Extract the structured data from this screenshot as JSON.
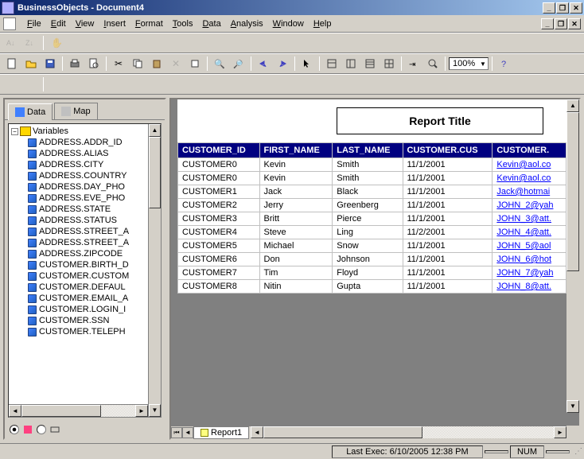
{
  "window": {
    "title": "BusinessObjects - Document4"
  },
  "menus": [
    "File",
    "Edit",
    "View",
    "Insert",
    "Format",
    "Tools",
    "Data",
    "Analysis",
    "Window",
    "Help"
  ],
  "zoom": "100%",
  "left": {
    "tabs": {
      "data": "Data",
      "map": "Map"
    },
    "root": "Variables",
    "items": [
      "ADDRESS.ADDR_ID",
      "ADDRESS.ALIAS",
      "ADDRESS.CITY",
      "ADDRESS.COUNTRY",
      "ADDRESS.DAY_PHO",
      "ADDRESS.EVE_PHO",
      "ADDRESS.STATE",
      "ADDRESS.STATUS",
      "ADDRESS.STREET_A",
      "ADDRESS.STREET_A",
      "ADDRESS.ZIPCODE",
      "CUSTOMER.BIRTH_D",
      "CUSTOMER.CUSTOM",
      "CUSTOMER.DEFAUL",
      "CUSTOMER.EMAIL_A",
      "CUSTOMER.LOGIN_I",
      "CUSTOMER.SSN",
      "CUSTOMER.TELEPH"
    ]
  },
  "report": {
    "title": "Report Title",
    "headers": [
      "CUSTOMER_ID",
      "FIRST_NAME",
      "LAST_NAME",
      "CUSTOMER.CUS",
      "CUSTOMER."
    ],
    "rows": [
      {
        "id": "CUSTOMER0",
        "first": "Kevin",
        "last": "Smith",
        "date": "11/1/2001",
        "email": "Kevin@aol.co"
      },
      {
        "id": "CUSTOMER0",
        "first": "Kevin",
        "last": "Smith",
        "date": "11/1/2001",
        "email": "Kevin@aol.co"
      },
      {
        "id": "CUSTOMER1",
        "first": "Jack",
        "last": "Black",
        "date": "11/1/2001",
        "email": "Jack@hotmai"
      },
      {
        "id": "CUSTOMER2",
        "first": "Jerry",
        "last": "Greenberg",
        "date": "11/1/2001",
        "email": "JOHN_2@yah"
      },
      {
        "id": "CUSTOMER3",
        "first": "Britt",
        "last": "Pierce",
        "date": "11/1/2001",
        "email": "JOHN_3@att."
      },
      {
        "id": "CUSTOMER4",
        "first": "Steve",
        "last": "Ling",
        "date": "11/2/2001",
        "email": "JOHN_4@att."
      },
      {
        "id": "CUSTOMER5",
        "first": "Michael",
        "last": "Snow",
        "date": "11/1/2001",
        "email": "JOHN_5@aol"
      },
      {
        "id": "CUSTOMER6",
        "first": "Don",
        "last": "Johnson",
        "date": "11/1/2001",
        "email": "JOHN_6@hot"
      },
      {
        "id": "CUSTOMER7",
        "first": "Tim",
        "last": "Floyd",
        "date": "11/1/2001",
        "email": "JOHN_7@yah"
      },
      {
        "id": "CUSTOMER8",
        "first": "Nitin",
        "last": "Gupta",
        "date": "11/1/2001",
        "email": "JOHN_8@att."
      }
    ],
    "tab": "Report1"
  },
  "status": {
    "exec": "Last Exec: 6/10/2005   12:38 PM",
    "num": "NUM"
  }
}
